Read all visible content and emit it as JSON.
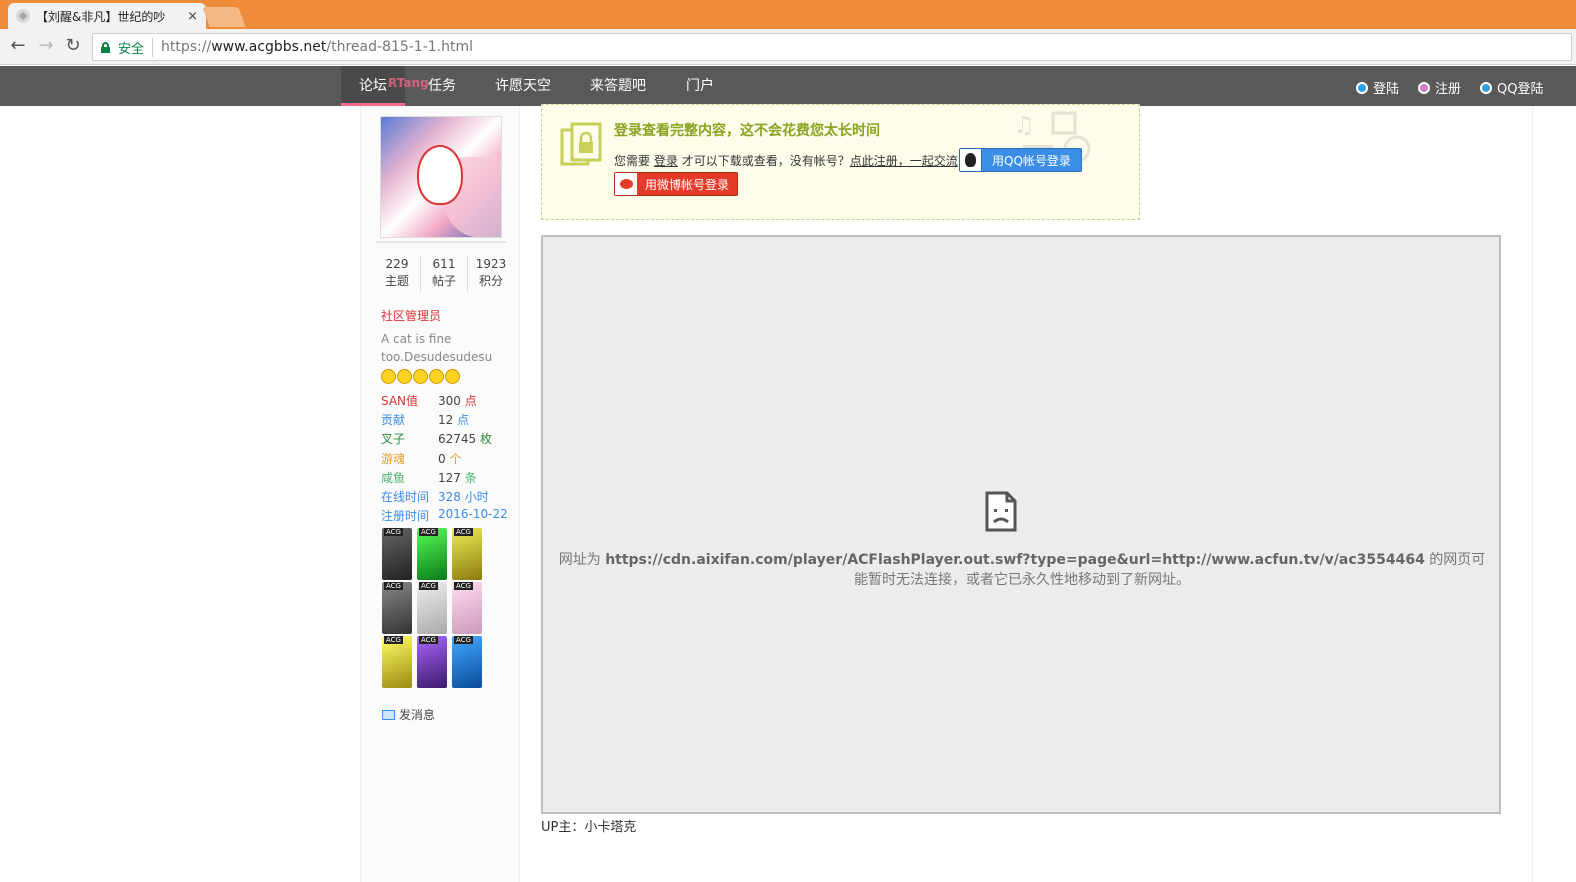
{
  "browser": {
    "tab_title": "【刘醒&非凡】世纪的吵",
    "tab_close": "×",
    "back_icon": "arrow-left-icon",
    "forward_icon": "arrow-right-icon",
    "reload_icon": "reload-icon",
    "secure_label": "安全",
    "url_scheme": "https://",
    "url_host": "www.acgbbs.net",
    "url_path": "/thread-815-1-1.html"
  },
  "nav": {
    "active": "论坛",
    "rt_overlay": "RTang",
    "items": [
      "任务",
      "许愿天空",
      "来答题吧",
      "门户"
    ],
    "right": {
      "login": "登陆",
      "register": "注册",
      "qq_login": "QQ登陆"
    }
  },
  "profile": {
    "stats": [
      {
        "value": "229",
        "label": "主题"
      },
      {
        "value": "611",
        "label": "帖子"
      },
      {
        "value": "1923",
        "label": "积分"
      }
    ],
    "role": "社区管理员",
    "bio": "A cat is fine too.Desudesudesu",
    "fields": [
      {
        "key": "SAN值",
        "value": "300",
        "unit": "点",
        "color": "#d33"
      },
      {
        "key": "贡献",
        "value": "12",
        "unit": "点",
        "color": "#3a8ee6"
      },
      {
        "key": "叉子",
        "value": "62745",
        "unit": "枚",
        "color": "#2a8a3a"
      },
      {
        "key": "游魂",
        "value": "0",
        "unit": "个",
        "color": "#e8a02a"
      },
      {
        "key": "咸鱼",
        "value": "127",
        "unit": "条",
        "color": "#4bb56a"
      },
      {
        "key": "在线时间",
        "value": "328",
        "unit": "小时",
        "color": "#3a8ee6"
      },
      {
        "key": "注册时间",
        "value": "2016-10-22",
        "unit": "",
        "color": "#3a8ee6"
      }
    ],
    "send_message": "发消息"
  },
  "login_prompt": {
    "title": "登录查看完整内容，这不会花费您太长时间",
    "prefix": "您需要",
    "login_link": "登录",
    "middle": "才可以下载或查看，没有帐号？",
    "register_link": "点此注册，一起交流",
    "qq_button": "用QQ帐号登录",
    "weibo_button": "用微博帐号登录"
  },
  "embed": {
    "prefix": "网址为 ",
    "url": "https://cdn.aixifan.com/player/ACFlashPlayer.out.swf?type=page&url=http://www.acfun.tv/v/ac3554464",
    "suffix": " 的网页可能暂时无法连接，或者它已永久性地移动到了新网址。"
  },
  "uploader": "UP主：小卡塔克",
  "colors": {
    "tabbar": "#ef8c3a",
    "nav": "#595959",
    "accent_pink": "#ff6a8a",
    "login_green": "#8aa321"
  }
}
